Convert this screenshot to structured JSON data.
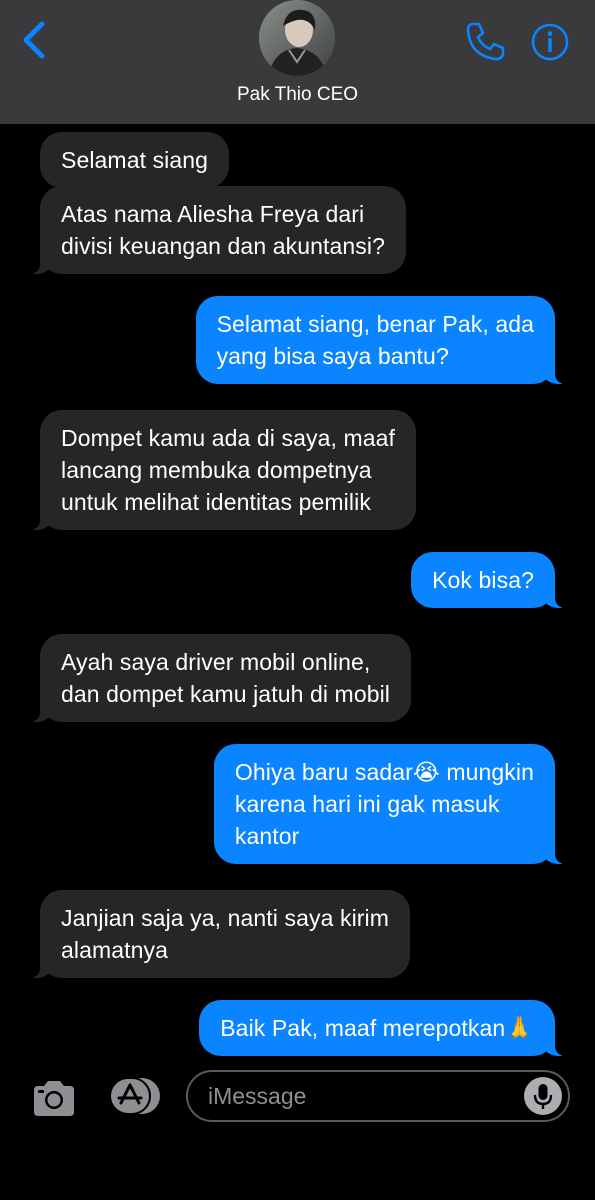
{
  "header": {
    "contact_name": "Pak Thio CEO",
    "back_icon": "chevron-left-icon",
    "call_icon": "phone-icon",
    "info_icon": "info-icon",
    "accent_color": "#0a84ff"
  },
  "messages": [
    {
      "direction": "incoming",
      "text": "Selamat siang"
    },
    {
      "direction": "incoming",
      "text": "Atas nama Aliesha Freya dari\ndivisi keuangan dan akuntansi?"
    },
    {
      "direction": "outgoing",
      "text": "Selamat siang, benar Pak, ada\nyang bisa saya bantu?"
    },
    {
      "direction": "incoming",
      "text": "Dompet kamu ada di saya, maaf\nlancang membuka dompetnya\nuntuk melihat identitas pemilik"
    },
    {
      "direction": "outgoing",
      "text": "Kok bisa?"
    },
    {
      "direction": "incoming",
      "text": "Ayah saya driver mobil online,\ndan dompet kamu jatuh di mobil"
    },
    {
      "direction": "outgoing",
      "text": "Ohiya baru sadar😭 mungkin\nkarena hari ini gak masuk\nkantor"
    },
    {
      "direction": "incoming",
      "text": "Janjian saja ya, nanti saya kirim\nalamatnya"
    },
    {
      "direction": "outgoing",
      "text": "Baik Pak, maaf merepotkan🙏"
    }
  ],
  "composer": {
    "placeholder": "iMessage",
    "camera_icon": "camera-icon",
    "apps_icon": "app-store-icon",
    "mic_icon": "microphone-icon"
  },
  "colors": {
    "incoming_bubble": "#262628",
    "outgoing_bubble": "#0a84ff",
    "header_bg": "#3a3a3c"
  }
}
